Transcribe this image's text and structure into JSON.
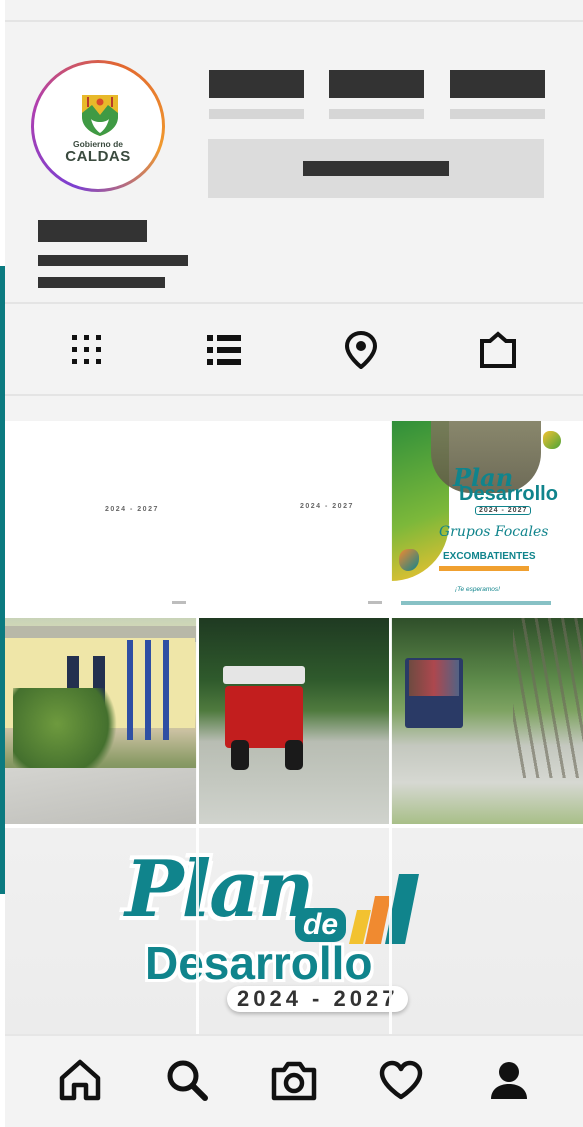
{
  "profile": {
    "logo_line1": "Gobierno de",
    "logo_line2": "CALDAS"
  },
  "tabs": [
    {
      "name": "grid-icon"
    },
    {
      "name": "list-icon"
    },
    {
      "name": "location-pin-icon"
    },
    {
      "name": "tagged-icon"
    }
  ],
  "grid": {
    "cell1_text": "2024 - 2027",
    "cell2_text": "2024 - 2027",
    "poster": {
      "title_line1": "Plan",
      "title_line2": "Desarrollo",
      "years": "2024 - 2027",
      "subtitle": "Grupos Focales",
      "category": "EXCOMBATIENTES",
      "cta": "¡Te esperamos!"
    },
    "banner": {
      "plan": "Plan",
      "de": "de",
      "desarrollo": "Desarrollo",
      "years": "2024 - 2027"
    }
  },
  "bottom_nav": [
    {
      "name": "home-icon"
    },
    {
      "name": "search-icon"
    },
    {
      "name": "camera-icon"
    },
    {
      "name": "heart-icon"
    },
    {
      "name": "profile-icon"
    }
  ],
  "colors": {
    "accent": "#0b7a80",
    "brand_teal": "#10848c",
    "placeholder_dark": "#333333",
    "placeholder_light": "#d6d6d6"
  }
}
